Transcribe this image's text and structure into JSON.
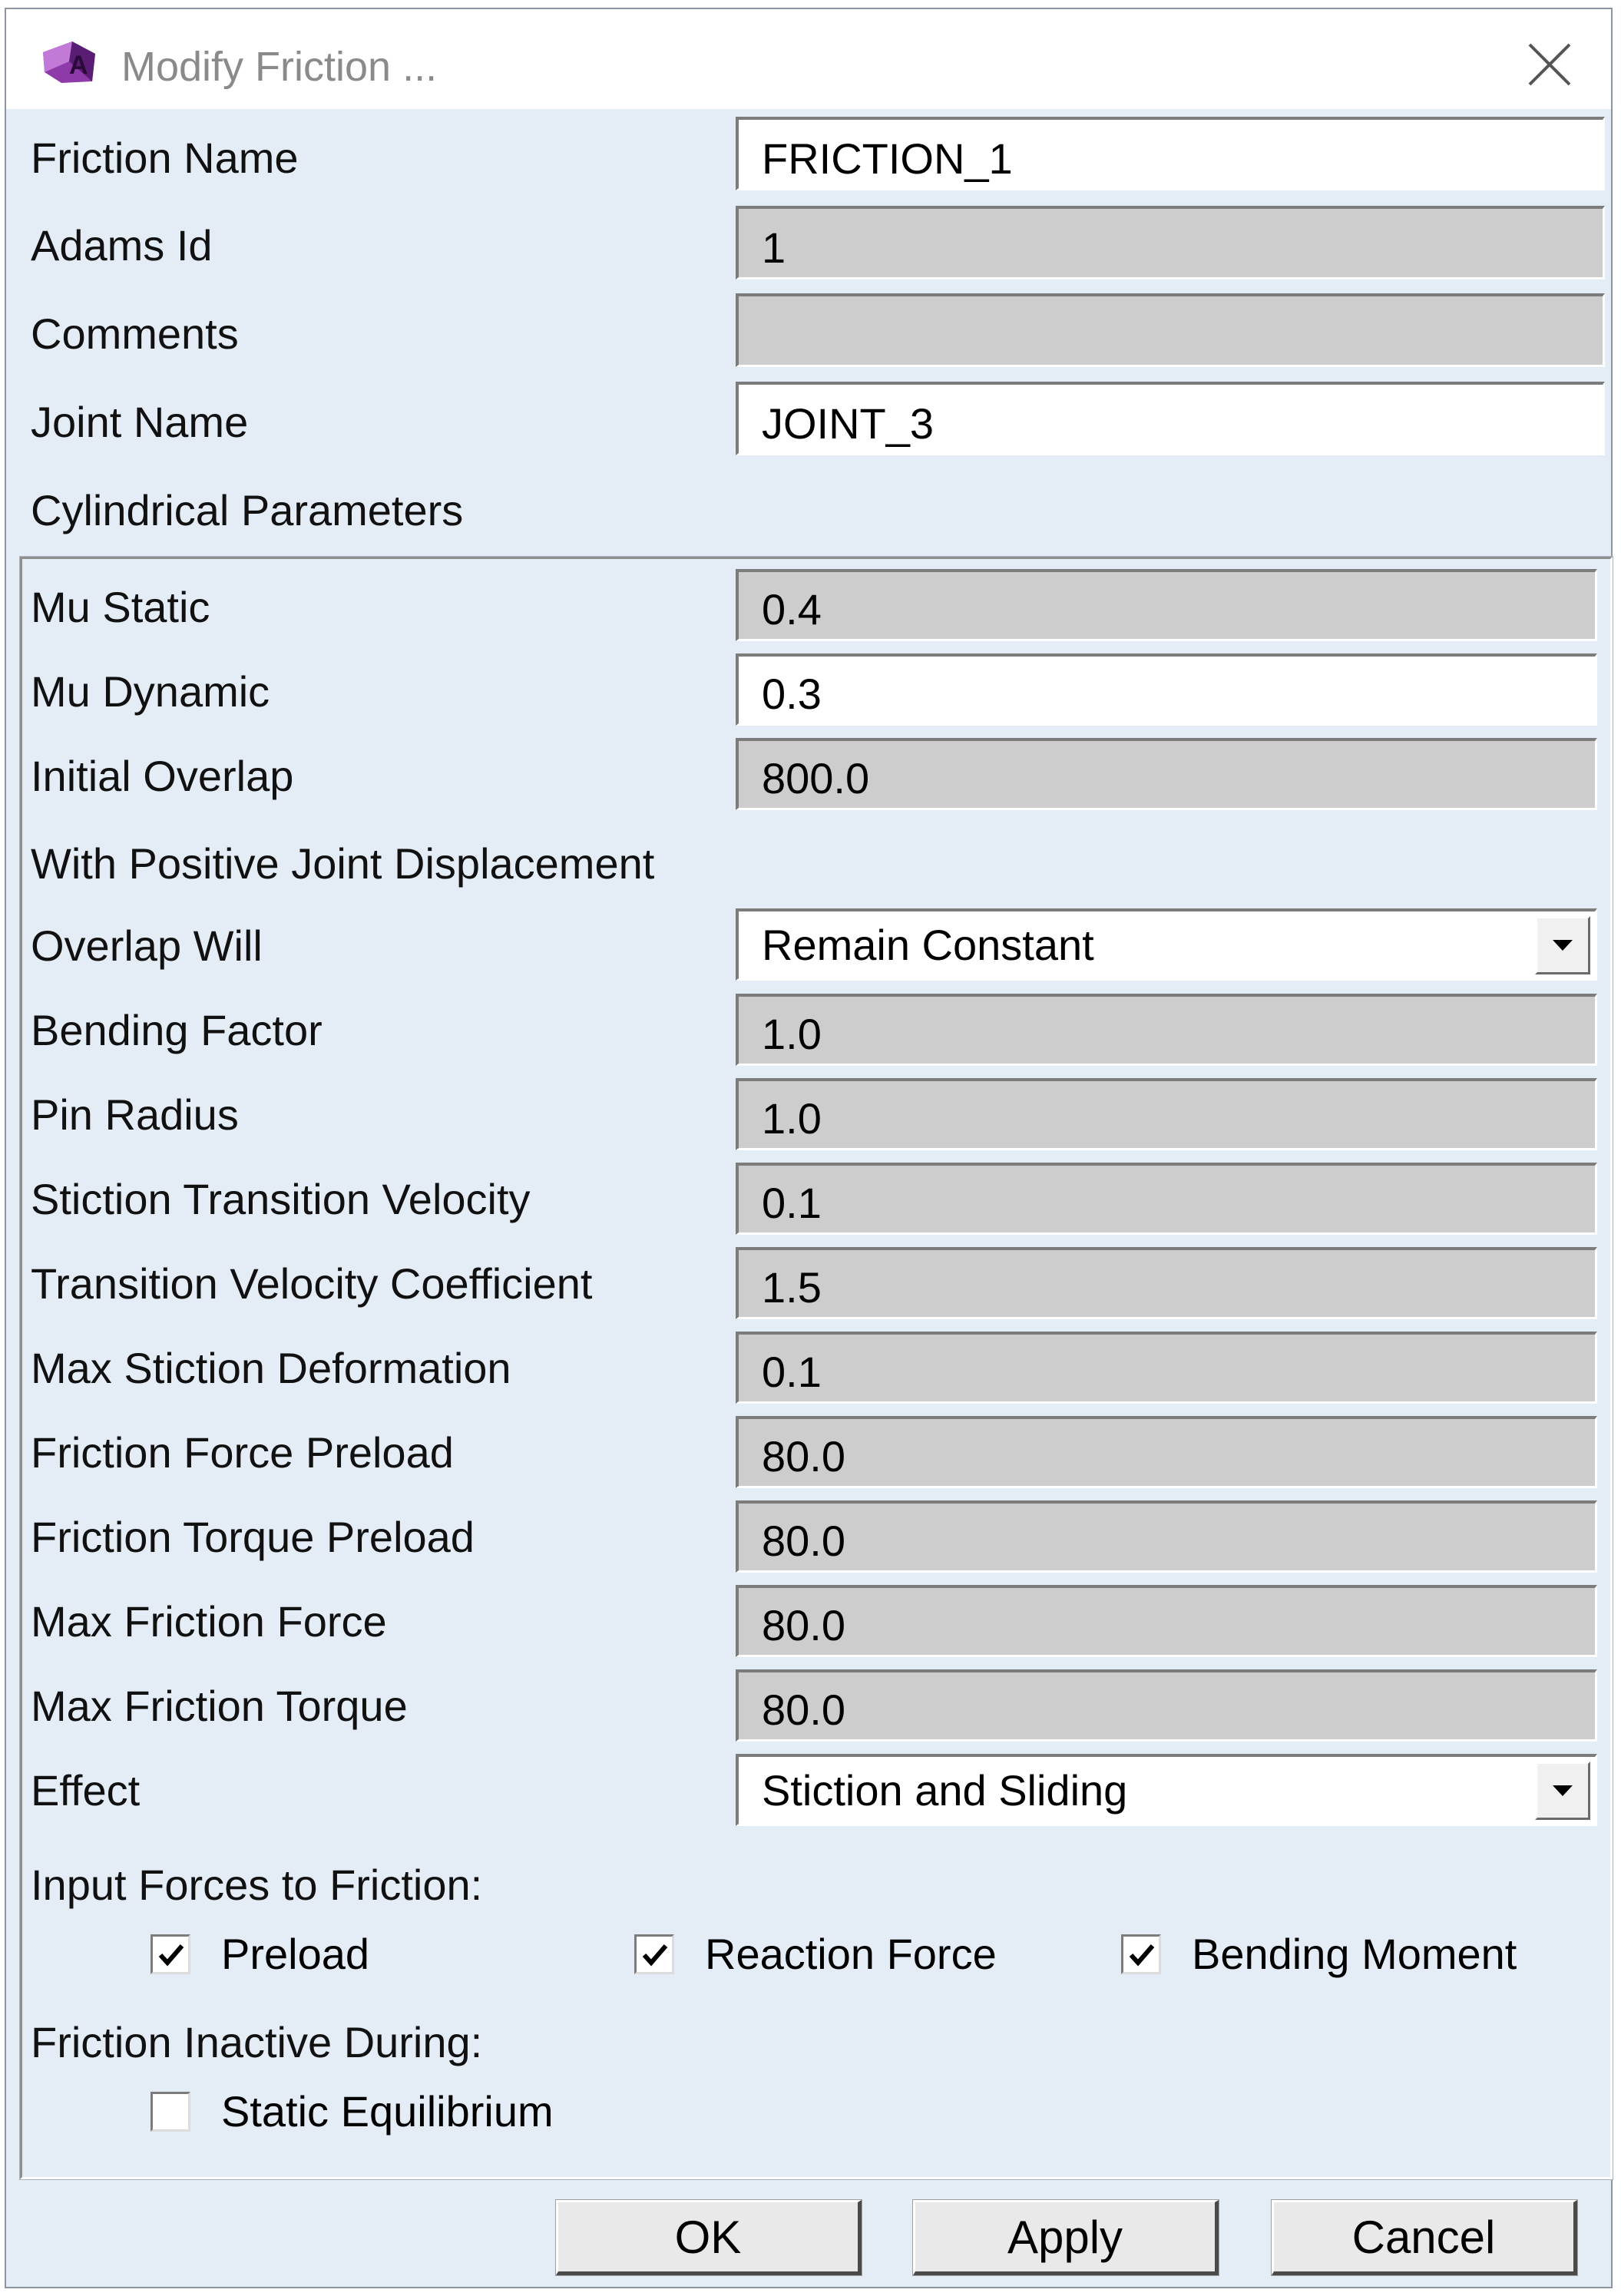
{
  "window": {
    "title": "Modify Friction ...",
    "close_icon": "close-icon",
    "app_icon": "adams-logo-icon"
  },
  "general": {
    "friction_name": {
      "label": "Friction Name",
      "value": "FRICTION_1"
    },
    "adams_id": {
      "label": "Adams Id",
      "value": "1"
    },
    "comments": {
      "label": "Comments",
      "value": ""
    },
    "joint_name": {
      "label": "Joint Name",
      "value": "JOINT_3"
    },
    "section_label": "Cylindrical Parameters"
  },
  "params": {
    "mu_static": {
      "label": "Mu Static",
      "value": "0.4"
    },
    "mu_dynamic": {
      "label": "Mu Dynamic",
      "value": "0.3"
    },
    "initial_overlap": {
      "label": "Initial Overlap",
      "value": "800.0"
    },
    "positive_displacement_label": "With Positive Joint Displacement",
    "overlap_will": {
      "label": "Overlap Will",
      "value": "Remain Constant"
    },
    "bending_factor": {
      "label": "Bending Factor",
      "value": "1.0"
    },
    "pin_radius": {
      "label": "Pin Radius",
      "value": "1.0"
    },
    "stiction_transition_velocity": {
      "label": "Stiction Transition Velocity",
      "value": "0.1"
    },
    "transition_velocity_coefficient": {
      "label": "Transition Velocity Coefficient",
      "value": "1.5"
    },
    "max_stiction_deformation": {
      "label": "Max Stiction Deformation",
      "value": "0.1"
    },
    "friction_force_preload": {
      "label": "Friction Force Preload",
      "value": "80.0"
    },
    "friction_torque_preload": {
      "label": "Friction Torque Preload",
      "value": "80.0"
    },
    "max_friction_force": {
      "label": "Max Friction Force",
      "value": "80.0"
    },
    "max_friction_torque": {
      "label": "Max Friction Torque",
      "value": "80.0"
    },
    "effect": {
      "label": "Effect",
      "value": "Stiction and Sliding"
    }
  },
  "input_forces": {
    "label": "Input Forces to Friction:",
    "preload": {
      "label": "Preload",
      "checked": true
    },
    "reaction_force": {
      "label": "Reaction Force",
      "checked": true
    },
    "bending_moment": {
      "label": "Bending Moment",
      "checked": true
    }
  },
  "inactive_during": {
    "label": "Friction Inactive During:",
    "static_equilibrium": {
      "label": "Static Equilibrium",
      "checked": false
    }
  },
  "buttons": {
    "ok": "OK",
    "apply": "Apply",
    "cancel": "Cancel"
  },
  "colors": {
    "window_bg": "#e4edf6",
    "readonly_field": "#cdcdcd",
    "editable_field": "#ffffff",
    "title_text": "#8a8a8a"
  }
}
